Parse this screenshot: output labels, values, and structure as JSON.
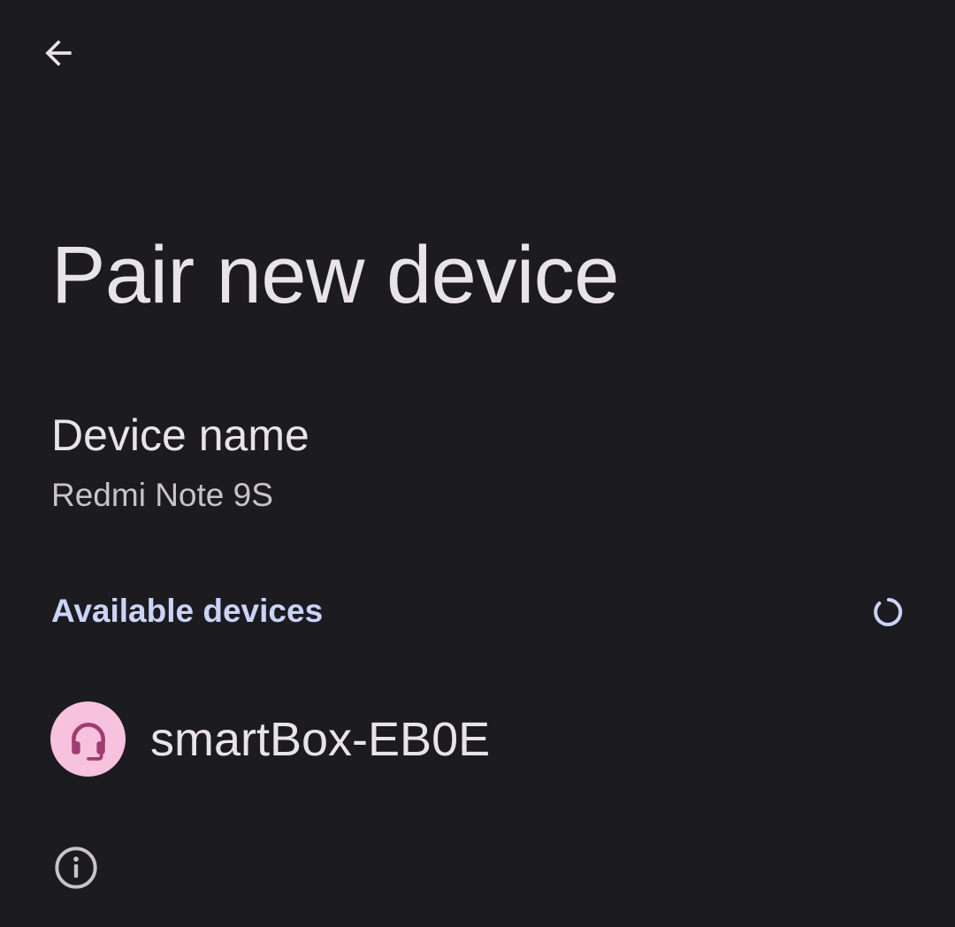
{
  "header": {
    "back_icon": "arrow-back-icon"
  },
  "page": {
    "title": "Pair new device"
  },
  "device_name": {
    "title": "Device name",
    "value": "Redmi Note 9S"
  },
  "available": {
    "header": "Available devices",
    "spinner_icon": "loading-spinner-icon",
    "devices": [
      {
        "name": "smartBox-EB0E",
        "icon": "headset-icon",
        "icon_bg": "#f7c2dd",
        "icon_fg": "#a13b72"
      }
    ]
  },
  "footer": {
    "info_icon": "info-icon"
  },
  "colors": {
    "background": "#1c1b20",
    "accent": "#c9d4f7",
    "primary_text": "#e8e3e9",
    "secondary_text": "#c8c3cb"
  }
}
